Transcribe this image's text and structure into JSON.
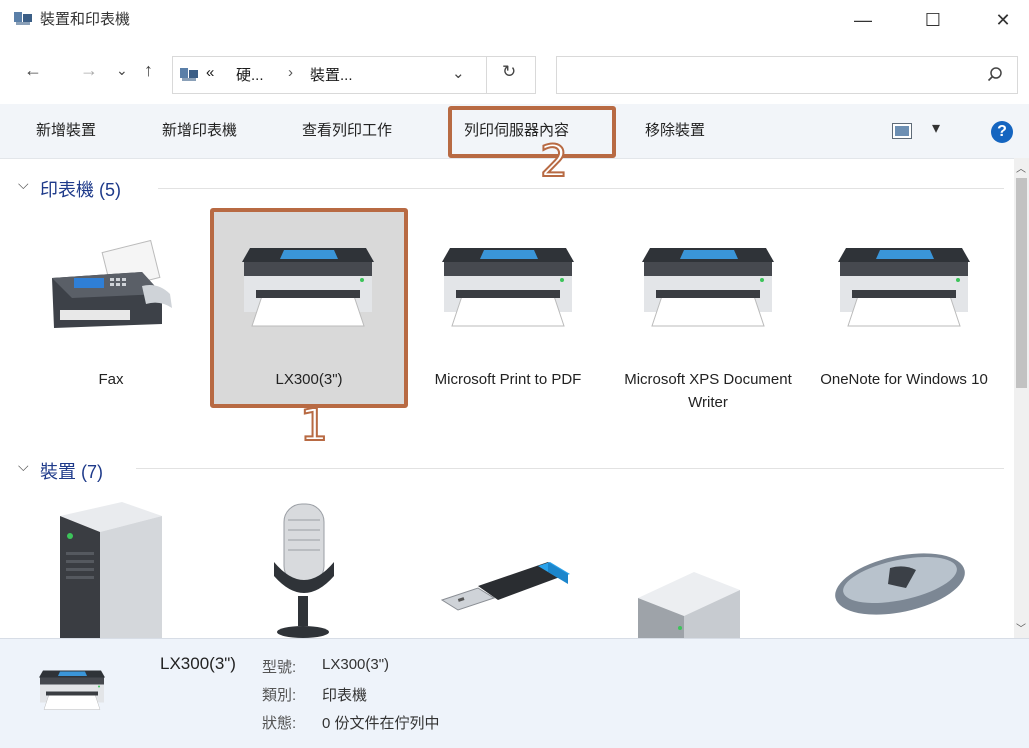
{
  "window": {
    "title": "裝置和印表機",
    "minimize": "—",
    "maximize": "☐",
    "close": "✕"
  },
  "nav": {
    "back": "←",
    "forward": "→",
    "recent": "⌄",
    "up": "↑",
    "breadcrumb_prefix": "«",
    "crumb1": "硬...",
    "crumb_sep": "›",
    "crumb2": "裝置...",
    "dropdown": "⌄",
    "refresh": "↻",
    "search_placeholder": ""
  },
  "toolbar": {
    "add_device": "新增裝置",
    "add_printer": "新增印表機",
    "see_print_jobs": "查看列印工作",
    "print_server_props": "列印伺服器內容",
    "remove_device": "移除裝置",
    "view_dropdown": "▾",
    "help": "?"
  },
  "groups": {
    "printers": {
      "header": "印表機 (5)",
      "items": [
        "Fax",
        "LX300(3\")",
        "Microsoft Print to PDF",
        "Microsoft XPS Document Writer",
        "OneNote for Windows 10"
      ]
    },
    "devices": {
      "header": "裝置 (7)"
    }
  },
  "details": {
    "name": "LX300(3\")",
    "model_label": "型號:",
    "model_value": "LX300(3\")",
    "category_label": "類別:",
    "category_value": "印表機",
    "status_label": "狀態:",
    "status_value": "0 份文件在佇列中"
  },
  "annotations": {
    "one": "1",
    "two": "2"
  },
  "colors": {
    "annotation": "#b86a43",
    "toolbar_bg": "#f2f5f9",
    "details_bg": "#eef3fa",
    "selected_bg": "#d9d9d9",
    "help_blue": "#1565c0"
  }
}
